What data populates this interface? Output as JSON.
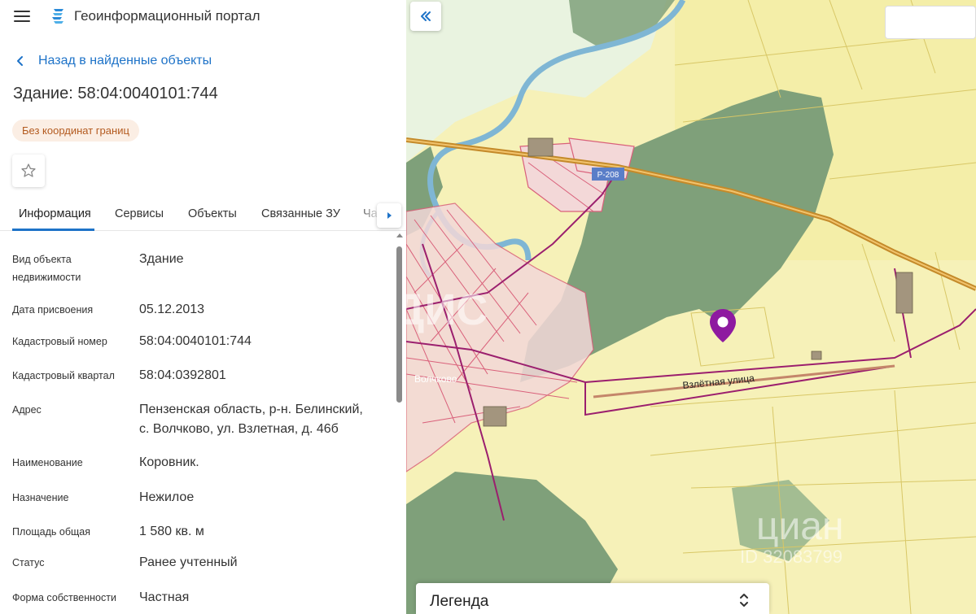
{
  "header": {
    "app_title": "Геоинформационный портал",
    "menu_icon": "hamburger-menu-icon",
    "logo_icon": "portal-logo-icon"
  },
  "back_link": {
    "label": "Назад в найденные объекты",
    "icon": "chevron-left-icon"
  },
  "object": {
    "title": "Здание: 58:04:0040101:744",
    "badge": "Без координат границ",
    "favorite_icon": "star-outline-icon"
  },
  "tabs": [
    {
      "label": "Информация",
      "active": true
    },
    {
      "label": "Сервисы",
      "active": false
    },
    {
      "label": "Объекты",
      "active": false
    },
    {
      "label": "Связанные ЗУ",
      "active": false
    },
    {
      "label": "Ча",
      "active": false
    }
  ],
  "info_rows": [
    {
      "label_lines": [
        "Вид объекта",
        "недвижимости"
      ],
      "value_lines": [
        "Здание"
      ]
    },
    {
      "label_lines": [
        "Дата присвоения"
      ],
      "value_lines": [
        "05.12.2013"
      ]
    },
    {
      "label_lines": [
        "Кадастровый номер"
      ],
      "value_lines": [
        "58:04:0040101:744"
      ]
    },
    {
      "label_lines": [
        "Кадастровый квартал"
      ],
      "value_lines": [
        "58:04:0392801"
      ]
    },
    {
      "label_lines": [
        "Адрес"
      ],
      "value_lines": [
        "Пензенская область, р-н. Белинский,",
        "с. Волчково, ул. Взлетная, д. 46б"
      ]
    },
    {
      "label_lines": [
        "Наименование"
      ],
      "value_lines": [
        "Коровник."
      ]
    },
    {
      "label_lines": [
        "Назначение"
      ],
      "value_lines": [
        "Нежилое"
      ]
    },
    {
      "label_lines": [
        "Площадь общая"
      ],
      "value_lines": [
        "1 580 кв. м"
      ]
    },
    {
      "label_lines": [
        "Статус"
      ],
      "value_lines": [
        "Ранее учтенный"
      ]
    },
    {
      "label_lines": [
        "Форма собственности"
      ],
      "value_lines": [
        "Частная"
      ]
    }
  ],
  "map": {
    "street_label": "Взлётная  улица",
    "road_shield": "Р-208",
    "village_label": "Волчково",
    "legend_label": "Легенда",
    "search_placeholder": "",
    "marker_icon": "location-pin-icon",
    "collapse_icon": "double-chevron-left-icon",
    "watermark_1": "ДИС",
    "watermark_2": "циан",
    "watermark_3": "ID 32083799",
    "colors": {
      "field": "#f6f1b8",
      "forest": "#7fa07a",
      "river": "#7fb6d4",
      "road": "#c48a2a",
      "parcel_line": "#d9607a",
      "boundary": "#9b1f6e",
      "marker": "#8e1aa0",
      "accent": "#1e73c8"
    }
  }
}
